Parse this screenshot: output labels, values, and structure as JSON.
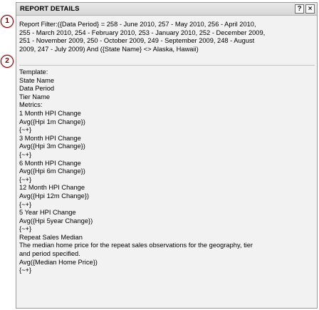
{
  "dialog": {
    "title": "REPORT DETAILS",
    "help_label": "?",
    "close_label": "×"
  },
  "callouts": [
    "1",
    "2"
  ],
  "filter": {
    "lines": [
      "Report Filter:({Data Period} = 258 - June 2010, 257 - May 2010, 256 - April 2010,",
      "255 - March 2010, 254 - February 2010, 253 - January 2010, 252 - December 2009,",
      "251 - November 2009, 250 - October 2009, 249 - September 2009, 248 - August",
      "2009, 247 - July 2009) And ({State Name} <> Alaska, Hawaii)"
    ]
  },
  "template": {
    "lines": [
      "Template:",
      "State Name",
      "Data Period",
      "Tier Name",
      "Metrics:",
      "1 Month HPI Change",
      "Avg({Hpi 1m Change})",
      "{~+}",
      "3 Month HPI Change",
      "Avg({Hpi 3m Change})",
      "{~+}",
      "6 Month HPI Change",
      "Avg({Hpi 6m Change})",
      "{~+}",
      "12 Month HPI Change",
      "Avg({Hpi 12m Change})",
      "{~+}",
      "5 Year HPI Change",
      "Avg({Hpi 5year Change})",
      "{~+}",
      "Repeat Sales Median",
      "The median home price for the repeat sales observations for the geography, tier",
      "and period specified.",
      "Avg({Median Home Price})",
      "{~+}"
    ]
  }
}
